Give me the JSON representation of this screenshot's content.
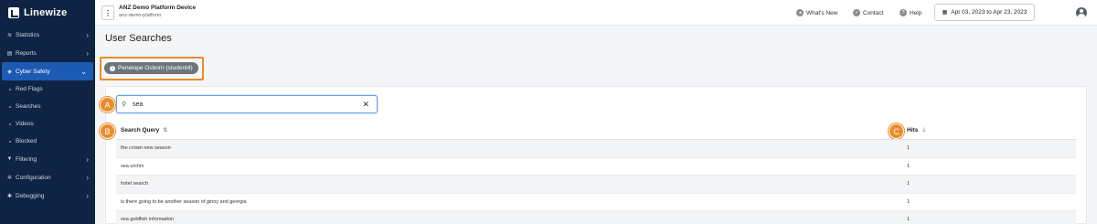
{
  "app": {
    "logo_text": "Linewize"
  },
  "sidebar": {
    "items": [
      {
        "label": "Statistics",
        "icon": "chart-icon",
        "active": false
      },
      {
        "label": "Reports",
        "icon": "document-icon",
        "active": false
      },
      {
        "label": "Cyber Safety",
        "icon": "shield-icon",
        "active": true
      },
      {
        "label": "Filtering",
        "icon": "filter-icon",
        "active": false
      },
      {
        "label": "Configuration",
        "icon": "gear-icon",
        "active": false
      },
      {
        "label": "Debugging",
        "icon": "bug-icon",
        "active": false
      }
    ],
    "sub_items": [
      "Red Flags",
      "Searches",
      "Videos",
      "Blocked"
    ]
  },
  "topbar": {
    "device_name": "ANZ Demo Platform Device",
    "device_sub": "anz-demo-platform",
    "whats_new": "What's New",
    "contact": "Contact",
    "help": "Help",
    "date_range": "Apr 03, 2023 to Apr 23, 2023"
  },
  "main": {
    "title": "User Searches",
    "user_chip": "Penelope Osborn (student4)",
    "search": {
      "value": "sea",
      "placeholder": ""
    },
    "markers": {
      "a": "A",
      "b": "B",
      "c": "C"
    },
    "table": {
      "headers": {
        "query": "Search Query",
        "hits": "Hits"
      },
      "rows": [
        {
          "query": "the crown new season",
          "hits": "1"
        },
        {
          "query": "sea urchin",
          "hits": "1"
        },
        {
          "query": "hotel search",
          "hits": "1"
        },
        {
          "query": "is there going to be another season of ginny and georgia",
          "hits": "1"
        },
        {
          "query": "sea goldfish information",
          "hits": "1"
        }
      ]
    }
  },
  "colors": {
    "sidebar_bg": "#0f2444",
    "active_blue": "#1c5bb4",
    "marker_orange": "#e88c2c"
  }
}
